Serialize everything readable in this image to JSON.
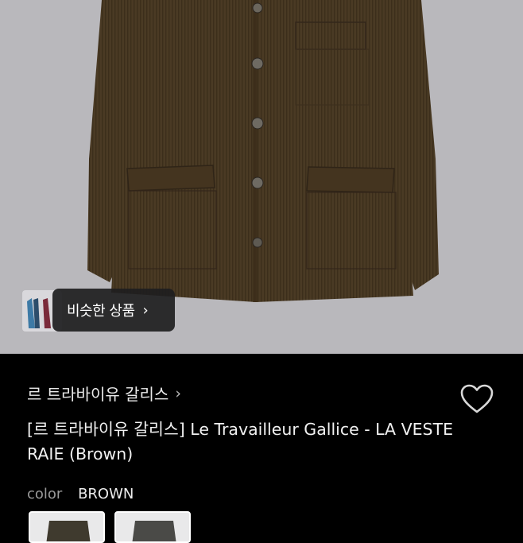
{
  "product_image": {
    "similar_button": {
      "label": "비슷한 상품",
      "chevron": "›"
    }
  },
  "product": {
    "brand": "르 트라바이유 갈리스",
    "brand_chevron": "›",
    "title": "[르 트라바이유 갈리스] Le Travailleur Gallice - LA VESTE RAIE (Brown)",
    "favorite_icon": "heart-outline-icon",
    "color_label": "color",
    "color_value": "BROWN"
  },
  "colors": {
    "background": "#000000",
    "photo_background": "#b9b8bc",
    "jacket": "#4a3a23"
  }
}
